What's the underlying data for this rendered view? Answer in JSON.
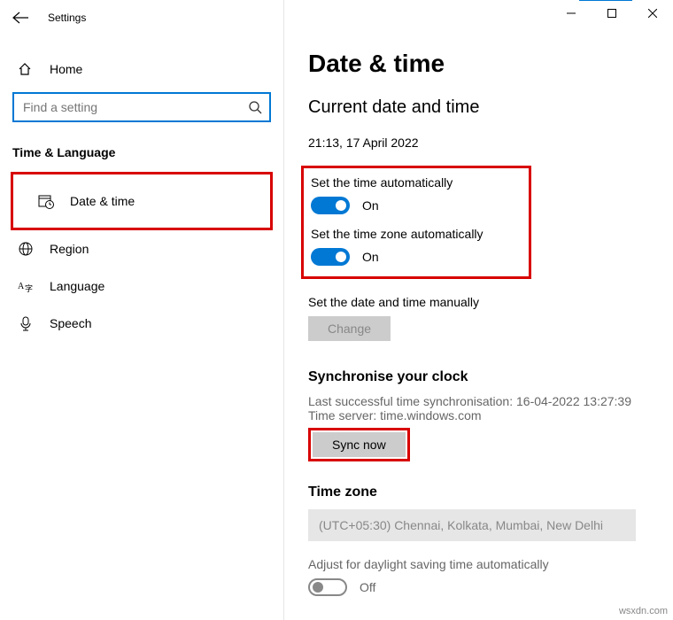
{
  "window": {
    "title": "Settings"
  },
  "sidebar": {
    "home_label": "Home",
    "search_placeholder": "Find a setting",
    "section_header": "Time & Language",
    "items": [
      {
        "label": "Date & time"
      },
      {
        "label": "Region"
      },
      {
        "label": "Language"
      },
      {
        "label": "Speech"
      }
    ]
  },
  "content": {
    "page_title": "Date & time",
    "section_current": "Current date and time",
    "current_datetime": "21:13, 17 April 2022",
    "auto_time": {
      "label": "Set the time automatically",
      "state": "On"
    },
    "auto_tz": {
      "label": "Set the time zone automatically",
      "state": "On"
    },
    "manual": {
      "label": "Set the date and time manually",
      "button": "Change"
    },
    "sync": {
      "heading": "Synchronise your clock",
      "last": "Last successful time synchronisation: 16-04-2022 13:27:39",
      "server": "Time server: time.windows.com",
      "button": "Sync now"
    },
    "timezone": {
      "heading": "Time zone",
      "value": "(UTC+05:30) Chennai, Kolkata, Mumbai, New Delhi"
    },
    "dst": {
      "label": "Adjust for daylight saving time automatically",
      "state": "Off"
    }
  },
  "watermark": "wsxdn.com"
}
